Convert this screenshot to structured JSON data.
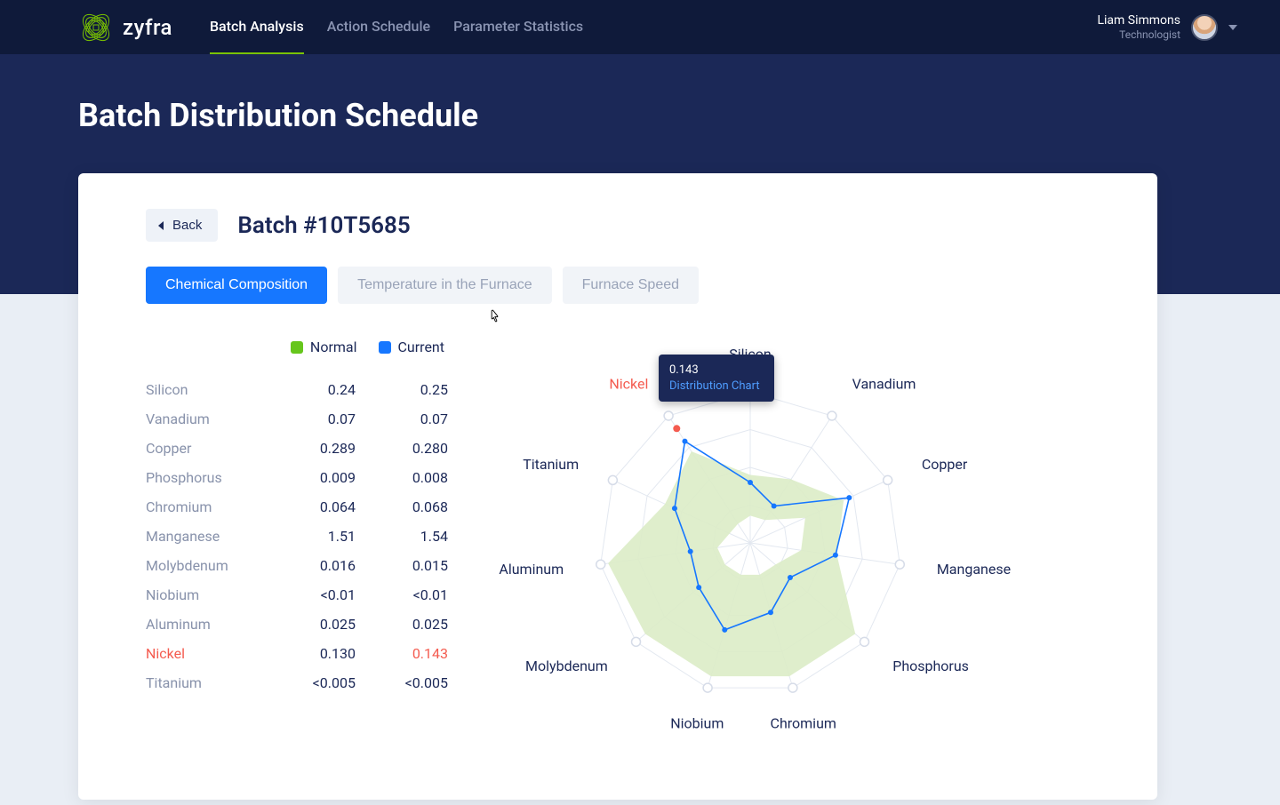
{
  "brand": {
    "name": "zyfra"
  },
  "nav": {
    "items": [
      {
        "label": "Batch Analysis",
        "active": true
      },
      {
        "label": "Action Schedule",
        "active": false
      },
      {
        "label": "Parameter Statistics",
        "active": false
      }
    ]
  },
  "user": {
    "name": "Liam Simmons",
    "role": "Technologist"
  },
  "page": {
    "title": "Batch Distribution Schedule"
  },
  "detail": {
    "back_label": "Back",
    "batch_title": "Batch #10T5685",
    "tabs": [
      {
        "label": "Chemical Composition",
        "active": true
      },
      {
        "label": "Temperature in the Furnace",
        "active": false
      },
      {
        "label": "Furnace Speed",
        "active": false
      }
    ],
    "legend": {
      "normal": "Normal",
      "current": "Current"
    },
    "rows": [
      {
        "label": "Silicon",
        "normal": "0.24",
        "current": "0.25",
        "alert": false
      },
      {
        "label": "Vanadium",
        "normal": "0.07",
        "current": "0.07",
        "alert": false
      },
      {
        "label": "Copper",
        "normal": "0.289",
        "current": "0.280",
        "alert": false
      },
      {
        "label": "Phosphorus",
        "normal": "0.009",
        "current": "0.008",
        "alert": false
      },
      {
        "label": "Chromium",
        "normal": "0.064",
        "current": "0.068",
        "alert": false
      },
      {
        "label": "Manganese",
        "normal": "1.51",
        "current": "1.54",
        "alert": false
      },
      {
        "label": "Molybdenum",
        "normal": "0.016",
        "current": "0.015",
        "alert": false
      },
      {
        "label": "Niobium",
        "normal": "<0.01",
        "current": "<0.01",
        "alert": false
      },
      {
        "label": "Aluminum",
        "normal": "0.025",
        "current": "0.025",
        "alert": false
      },
      {
        "label": "Nickel",
        "normal": "0.130",
        "current": "0.143",
        "alert": true
      },
      {
        "label": "Titanium",
        "normal": "<0.005",
        "current": "<0.005",
        "alert": false
      }
    ],
    "tooltip": {
      "value": "0.143",
      "link": "Distribution Chart"
    }
  },
  "chart_data": {
    "type": "radar",
    "categories": [
      "Silicon",
      "Vanadium",
      "Copper",
      "Manganese",
      "Phosphorus",
      "Chromium",
      "Niobium",
      "Molybdenum",
      "Aluminum",
      "Titanium",
      "Nickel"
    ],
    "rings": 4,
    "series": [
      {
        "name": "Normal band",
        "style": "area",
        "color": "#dcecc7",
        "values_outer": [
          0.45,
          0.5,
          0.68,
          0.58,
          0.92,
          0.92,
          0.92,
          0.92,
          0.95,
          0.62,
          0.72
        ],
        "values_inner": [
          0.18,
          0.18,
          0.4,
          0.34,
          0.22,
          0.22,
          0.22,
          0.22,
          0.22,
          0.15,
          0.15
        ]
      },
      {
        "name": "Current",
        "style": "line",
        "color": "#1677ff",
        "values": [
          0.4,
          0.29,
          0.72,
          0.57,
          0.35,
          0.48,
          0.6,
          0.45,
          0.4,
          0.55,
          0.8
        ]
      }
    ],
    "alert_axis": "Nickel",
    "alert_point_radius_frac": 0.9
  },
  "colors": {
    "bg_dark": "#1b2857",
    "accent_green": "#7ac300",
    "primary_blue": "#1677ff",
    "alert_red": "#f45b4f"
  }
}
